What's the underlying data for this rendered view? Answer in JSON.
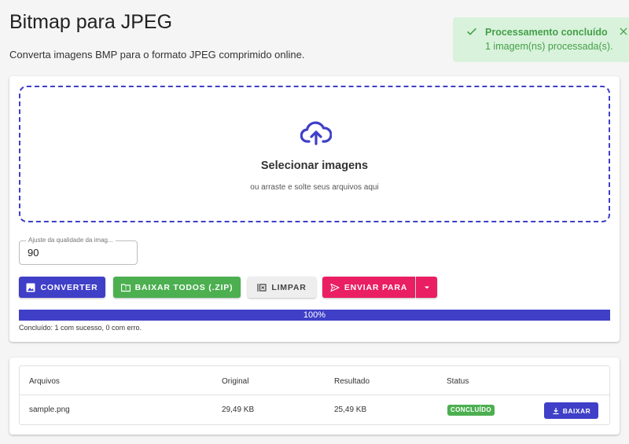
{
  "header": {
    "title": "Bitmap para JPEG",
    "subtitle": "Converta imagens BMP para o formato JPEG comprimido online."
  },
  "toast": {
    "title": "Processamento concluído",
    "message": "1 imagem(ns) processada(s).",
    "icon": "check-icon",
    "color": "#43a047"
  },
  "dropzone": {
    "icon": "cloud-upload-icon",
    "title": "Selecionar imagens",
    "subtitle": "ou arraste e solte seus arquivos aqui"
  },
  "quality": {
    "label": "Ajuste da qualidade da imag...",
    "value": "90"
  },
  "actions": {
    "convert": "CONVERTER",
    "download_all": "BAIXAR TODOS (.ZIP)",
    "clear": "LIMPAR",
    "send_to": "ENVIAR PARA"
  },
  "progress": {
    "value": 100,
    "label": "100%",
    "status": "Concluído: 1 com sucesso, 0 com erro."
  },
  "table": {
    "headers": [
      "Arquivos",
      "Original",
      "Resultado",
      "Status"
    ],
    "rows": [
      {
        "file": "sample.png",
        "original": "29,49 KB",
        "result": "25,49 KB",
        "status": "CONCLUÍDO",
        "action": "BAIXAR"
      }
    ]
  },
  "colors": {
    "primary": "#3f3fc8",
    "success": "#4caf50",
    "accent": "#e91e63"
  }
}
